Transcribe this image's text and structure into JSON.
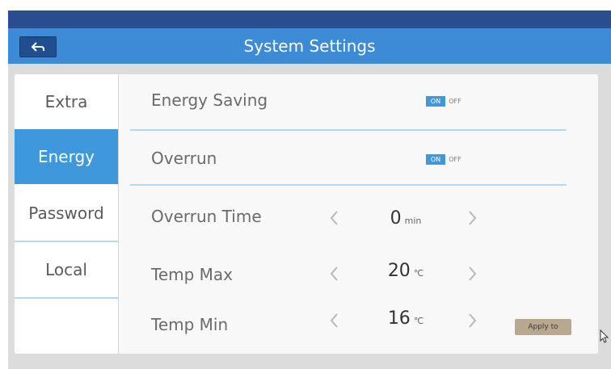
{
  "header": {
    "title": "System Settings",
    "back_icon": "back-arrow-icon"
  },
  "sidebar": {
    "items": [
      {
        "label": "Extra",
        "active": false
      },
      {
        "label": "Energy",
        "active": true
      },
      {
        "label": "Password",
        "active": false
      },
      {
        "label": "Local",
        "active": false
      }
    ]
  },
  "settings": {
    "energy_saving": {
      "label": "Energy Saving",
      "on_label": "ON",
      "off_label": "OFF",
      "state": "ON"
    },
    "overrun": {
      "label": "Overrun",
      "on_label": "ON",
      "off_label": "OFF",
      "state": "ON"
    },
    "overrun_time": {
      "label": "Overrun Time",
      "value": "0",
      "unit": "min"
    },
    "temp_max": {
      "label": "Temp Max",
      "value": "20",
      "unit": "℃"
    },
    "temp_min": {
      "label": "Temp Min",
      "value": "16",
      "unit": "℃"
    }
  },
  "actions": {
    "apply_label": "Apply to"
  },
  "colors": {
    "accent": "#3f97dc",
    "title_bar": "#3d8ad6",
    "top_dark": "#2a4d8f",
    "apply_button": "#b7a88f"
  }
}
